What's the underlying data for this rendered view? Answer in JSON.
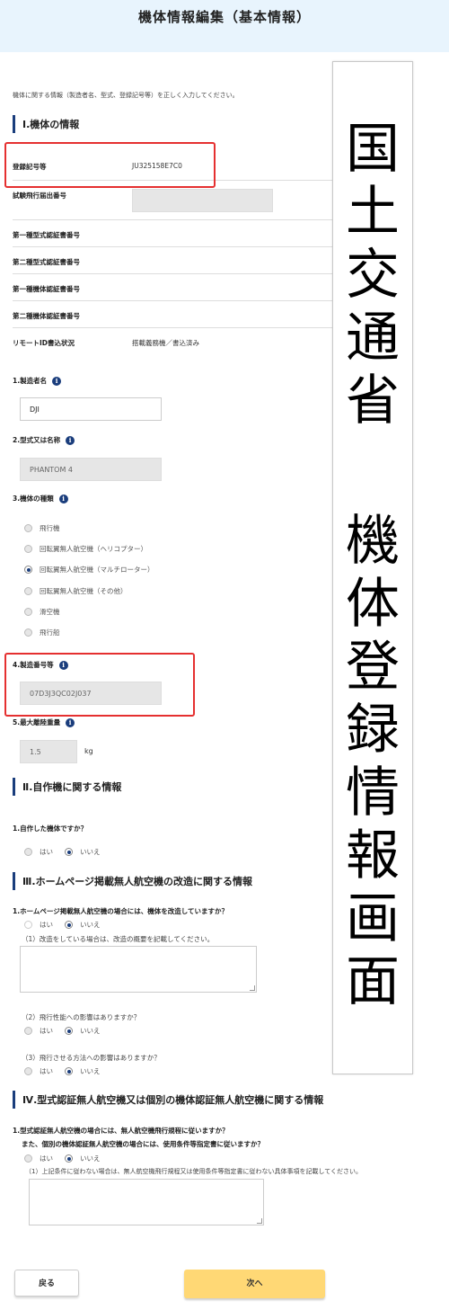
{
  "header": {
    "title": "機体情報編集（基本情報）"
  },
  "intro": "機体に関する情報（製造者名、型式、登録記号等）を正しく入力してください。",
  "section1": {
    "title": "Ⅰ.機体の情報",
    "rows": [
      {
        "label": "登録記号等",
        "value": "JU325158E7C0"
      },
      {
        "label": "試験飛行届出番号",
        "value": ""
      },
      {
        "label": "第一種型式認証書番号",
        "value": ""
      },
      {
        "label": "第二種型式認証書番号",
        "value": ""
      },
      {
        "label": "第一種機体認証書番号",
        "value": ""
      },
      {
        "label": "第二種機体認証書番号",
        "value": ""
      },
      {
        "label": "リモートID書込状況",
        "value": "搭載義務機／書込済み"
      }
    ]
  },
  "manufacturer": {
    "label": "1.製造者名",
    "value": "DJI"
  },
  "model": {
    "label": "2.型式又は名称",
    "value": "PHANTOM 4"
  },
  "aircraft_type": {
    "label": "3.機体の種類",
    "options": [
      "飛行機",
      "回転翼無人航空機（ヘリコプター）",
      "回転翼無人航空機（マルチローター）",
      "回転翼無人航空機（その他）",
      "滑空機",
      "飛行船"
    ],
    "selected": "回転翼無人航空機（マルチローター）"
  },
  "serial": {
    "label": "4.製造番号等",
    "value": "07D3J3QC02J037"
  },
  "weight": {
    "label": "5.最大離陸重量",
    "value": "1.5",
    "unit": "kg"
  },
  "section2": {
    "title": "Ⅱ.自作機に関する情報",
    "question": "1.自作した機体ですか？",
    "yes": "はい",
    "no": "いいえ"
  },
  "section3": {
    "title": "Ⅲ.ホームページ掲載無人航空機の改造に関する情報",
    "question": "1.ホームページ掲載無人航空機の場合には、機体を改造していますか？",
    "yes": "はい",
    "no": "いいえ",
    "q1": "（1）改造をしている場合は、改造の概要を記載してください。",
    "q2": "（2）飛行性能への影響はありますか？",
    "q3": "（3）飛行させる方法への影響はありますか？"
  },
  "section4": {
    "title": "Ⅳ.型式認証無人航空機又は個別の機体認証無人航空機に関する情報",
    "question1": "1.型式認証無人航空機の場合には、無人航空機飛行規程に従いますか？",
    "question2": "また、個別の機体認証無人航空機の場合には、使用条件等指定書に従いますか？",
    "yes": "はい",
    "no": "いいえ",
    "q1": "（1）上記条件に従わない場合は、無人航空機飛行規程又は使用条件等指定書に従わない具体事項を記載してください。"
  },
  "buttons": {
    "back": "戻る",
    "next": "次へ"
  },
  "annotation": {
    "line1": "国土交通省",
    "line2": "機体登録情報画面"
  }
}
